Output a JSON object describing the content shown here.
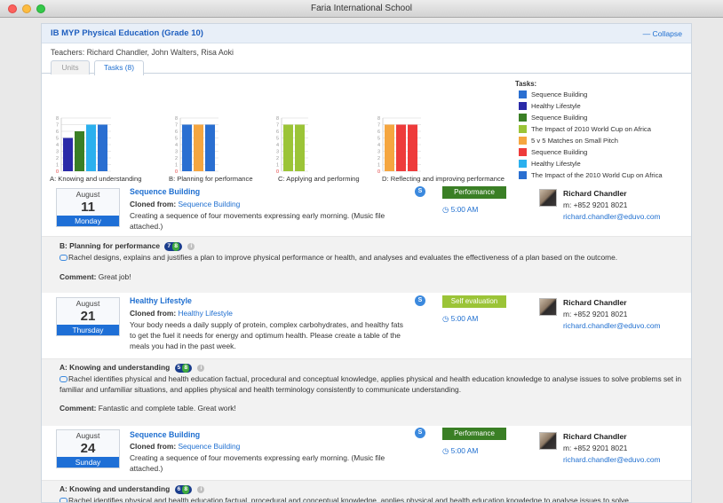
{
  "window": {
    "title": "Faria International School"
  },
  "course": {
    "title": "IB MYP Physical Education (Grade 10)",
    "collapse_label": "Collapse",
    "teachers": "Teachers: Richard Chandler, John Walters, Risa Aoki"
  },
  "tabs": [
    {
      "label": "Units",
      "active": false
    },
    {
      "label": "Tasks (8)",
      "active": true
    }
  ],
  "legend": {
    "title": "Tasks:",
    "items": [
      {
        "label": "Sequence Building",
        "color": "#2a6fd1"
      },
      {
        "label": "Healthy Lifestyle",
        "color": "#2a2aa8"
      },
      {
        "label": "Sequence Building",
        "color": "#3a7f25"
      },
      {
        "label": "The Impact of 2010 World Cup on Africa",
        "color": "#9bc437"
      },
      {
        "label": "5 v 5 Matches on Small Pitch",
        "color": "#f5a640"
      },
      {
        "label": "Sequence Building",
        "color": "#ee3b3b"
      },
      {
        "label": "Healthy Lifestyle",
        "color": "#2bb0ee"
      },
      {
        "label": "The Impact of the 2010 World Cup on Africa",
        "color": "#2a6fd1"
      }
    ]
  },
  "chart_data": [
    {
      "type": "bar",
      "title": "",
      "caption": "A: Knowing and understanding",
      "ylim": [
        0,
        8
      ],
      "y_ticks": [
        "8",
        "7",
        "6",
        "5",
        "4",
        "3",
        "2",
        "1",
        "0"
      ],
      "values": [
        5,
        6,
        7,
        7
      ],
      "colors": [
        "#2a2aa8",
        "#3a7f25",
        "#2bb0ee",
        "#2a6fd1"
      ]
    },
    {
      "type": "bar",
      "title": "",
      "caption": "B: Planning for performance",
      "ylim": [
        0,
        8
      ],
      "y_ticks": [
        "8",
        "7",
        "6",
        "5",
        "4",
        "3",
        "2",
        "1",
        "0"
      ],
      "values": [
        7,
        7,
        7
      ],
      "colors": [
        "#2a6fd1",
        "#f5a640",
        "#2a6fd1"
      ]
    },
    {
      "type": "bar",
      "title": "",
      "caption": "C: Applying and performing",
      "ylim": [
        0,
        8
      ],
      "y_ticks": [
        "8",
        "7",
        "6",
        "5",
        "4",
        "3",
        "2",
        "1",
        "0"
      ],
      "values": [
        7,
        7
      ],
      "colors": [
        "#9bc437",
        "#9bc437"
      ]
    },
    {
      "type": "bar",
      "title": "",
      "caption": "D: Reflecting and improving performance",
      "ylim": [
        0,
        8
      ],
      "y_ticks": [
        "8",
        "7",
        "6",
        "5",
        "4",
        "3",
        "2",
        "1",
        "0"
      ],
      "values": [
        7,
        7,
        7
      ],
      "colors": [
        "#f5a640",
        "#ee3b3b",
        "#ee3b3b"
      ]
    }
  ],
  "tasks": [
    {
      "month": "August",
      "day": "11",
      "weekday": "Monday",
      "title": "Sequence Building",
      "cloned_label": "Cloned from:",
      "cloned_from": "Sequence Building",
      "description": "Creating a sequence of four movements expressing early morning. (Music file attached.)",
      "s_badge": "S",
      "type": "Performance",
      "type_color": "#3a7f25",
      "time": "5:00 AM",
      "teacher": "Richard Chandler",
      "phone": "m: +852 9201 8021",
      "email": "richard.chandler@eduvo.com",
      "criterion": "B: Planning for performance",
      "score_a": "7",
      "score_b": "8",
      "criterion_text": "Rachel designs, explains and justifies a plan to improve physical performance or health, and analyses and evaluates the effectiveness of a plan based on the outcome.",
      "comment_label": "Comment:",
      "comment": "Great job!"
    },
    {
      "month": "August",
      "day": "21",
      "weekday": "Thursday",
      "title": "Healthy Lifestyle",
      "cloned_label": "Cloned from:",
      "cloned_from": "Healthy Lifestyle",
      "description": "Your body needs a daily supply of protein, complex carbohydrates, and healthy fats to get the fuel it needs for energy and optimum health. Please create a table of the meals you had in the past week.",
      "s_badge": "S",
      "type": "Self evaluation",
      "type_color": "#9bc437",
      "time": "5:00 AM",
      "teacher": "Richard Chandler",
      "phone": "m: +852 9201 8021",
      "email": "richard.chandler@eduvo.com",
      "criterion": "A: Knowing and understanding",
      "score_a": "5",
      "score_b": "8",
      "criterion_text": "Rachel identifies physical and health education factual, procedural and conceptual knowledge, applies physical and health education knowledge to analyse issues to solve problems set in familiar and unfamiliar situations, and applies physical and health terminology consistently to communicate understanding.",
      "comment_label": "Comment:",
      "comment": "Fantastic and complete table. Great work!"
    },
    {
      "month": "August",
      "day": "24",
      "weekday": "Sunday",
      "title": "Sequence Building",
      "cloned_label": "Cloned from:",
      "cloned_from": "Sequence Building",
      "description": "Creating a sequence of four movements expressing early morning. (Music file attached.)",
      "s_badge": "S",
      "type": "Performance",
      "type_color": "#3a7f25",
      "time": "5:00 AM",
      "teacher": "Richard Chandler",
      "phone": "m: +852 9201 8021",
      "email": "richard.chandler@eduvo.com",
      "criterion": "A: Knowing and understanding",
      "score_a": "6",
      "score_b": "8",
      "criterion_text": "Rachel identifies physical and health education factual, procedural and conceptual knowledge, applies physical and health education knowledge to analyse issues to solve",
      "comment_label": "",
      "comment": ""
    }
  ]
}
